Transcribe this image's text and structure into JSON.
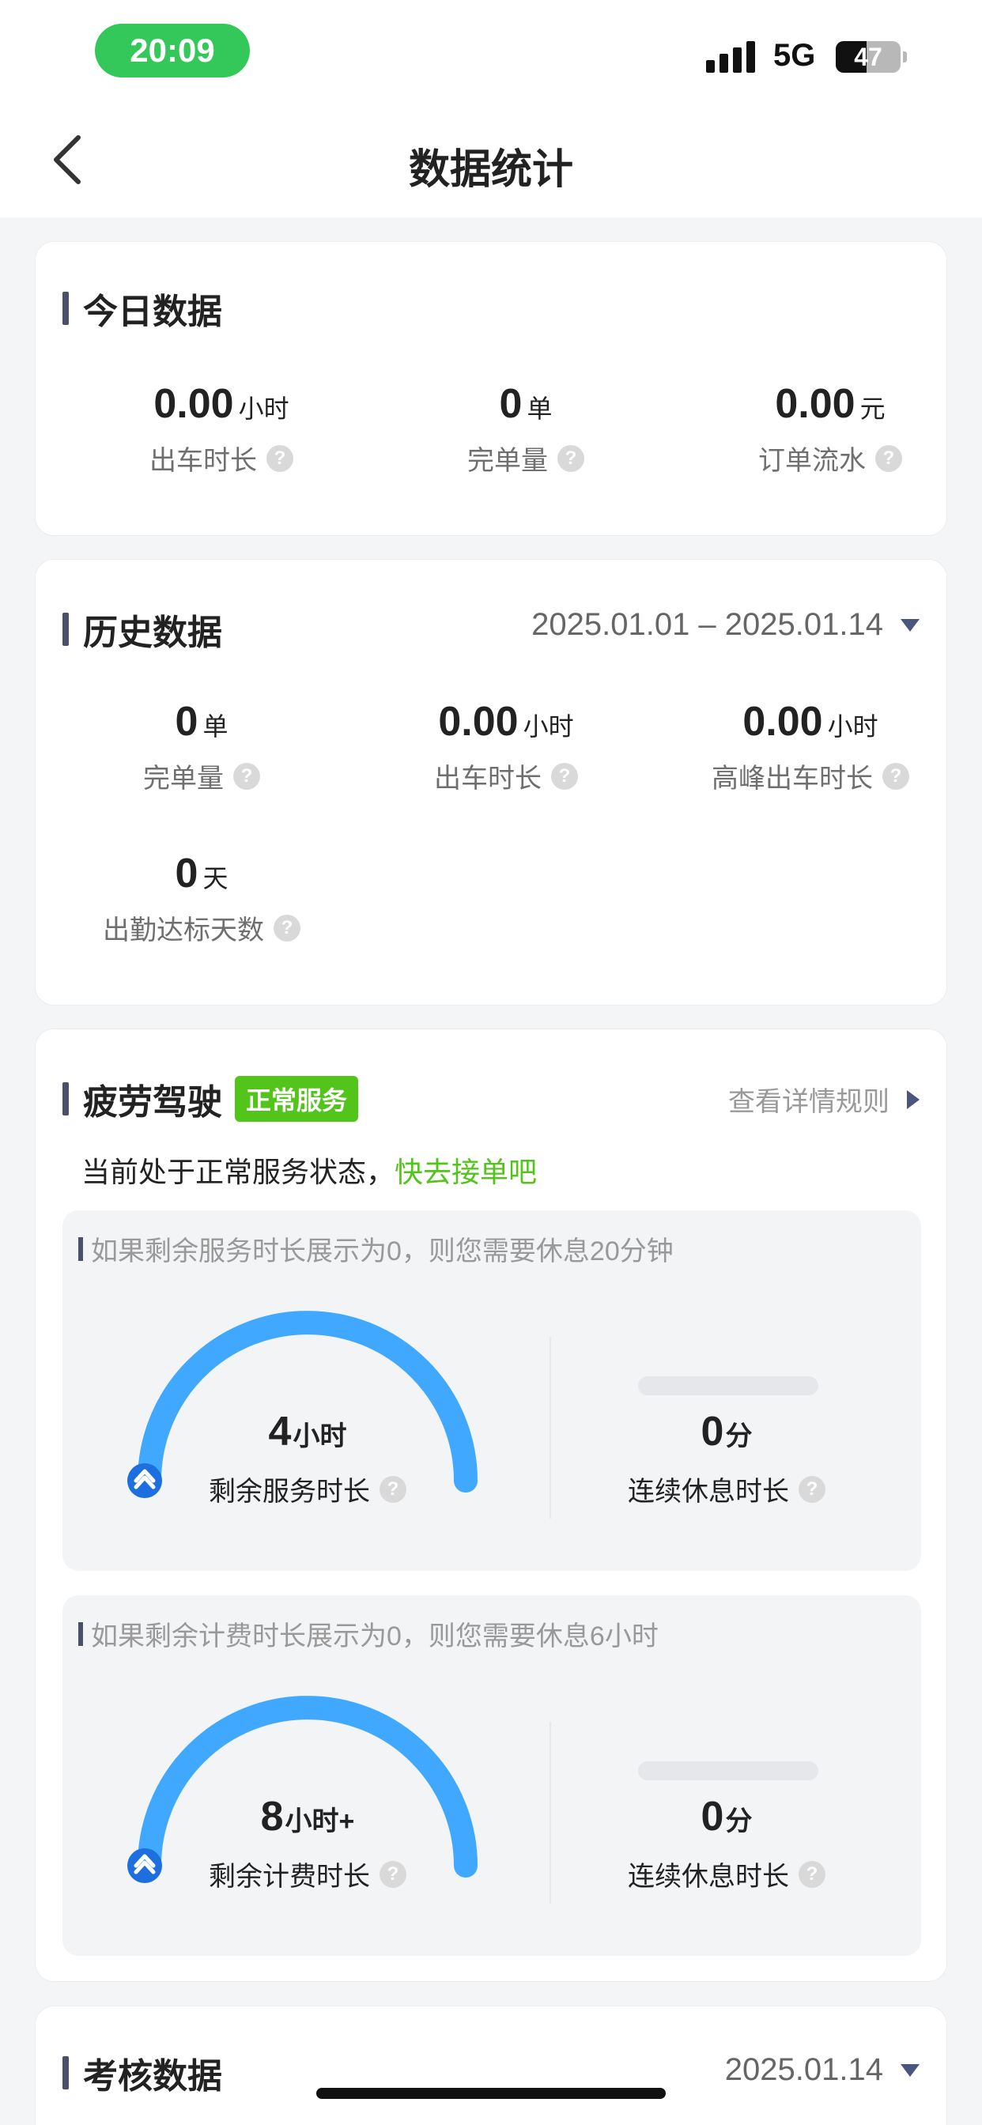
{
  "status_bar": {
    "time": "20:09",
    "network": "5G",
    "battery": "47",
    "battery_level": 0.47
  },
  "nav": {
    "title": "数据统计",
    "back_icon": "chevron-left-icon"
  },
  "today": {
    "title": "今日数据",
    "stats": [
      {
        "value": "0.00",
        "unit": "小时",
        "label": "出车时长"
      },
      {
        "value": "0",
        "unit": "单",
        "label": "完单量"
      },
      {
        "value": "0.00",
        "unit": "元",
        "label": "订单流水"
      }
    ]
  },
  "history": {
    "title": "历史数据",
    "date_range": "2025.01.01 – 2025.01.14",
    "stats": [
      {
        "value": "0",
        "unit": "单",
        "label": "完单量"
      },
      {
        "value": "0.00",
        "unit": "小时",
        "label": "出车时长"
      },
      {
        "value": "0.00",
        "unit": "小时",
        "label": "高峰出车时长"
      },
      {
        "value": "0",
        "unit": "天",
        "label": "出勤达标天数"
      }
    ]
  },
  "fatigue": {
    "title": "疲劳驾驶",
    "badge": "正常服务",
    "rules_link": "查看详情规则",
    "status_text": "当前处于正常服务状态，",
    "status_action": "快去接单吧",
    "panels": [
      {
        "hint": "如果剩余服务时长展示为0，则您需要休息20分钟",
        "gauge_value": "4",
        "gauge_unit": "小时",
        "gauge_label": "剩余服务时长",
        "rest_value": "0",
        "rest_unit": "分",
        "rest_label": "连续休息时长"
      },
      {
        "hint": "如果剩余计费时长展示为0，则您需要休息6小时",
        "gauge_value": "8",
        "gauge_unit": "小时+",
        "gauge_label": "剩余计费时长",
        "rest_value": "0",
        "rest_unit": "分",
        "rest_label": "连续休息时长"
      }
    ]
  },
  "assessment": {
    "title": "考核数据",
    "date": "2025.01.14"
  },
  "help_icon_glyph": "?",
  "colors": {
    "accent_green": "#52c41a",
    "gauge_blue": "#40a9ff",
    "marker_blue": "#1d6fe0",
    "status_green": "#34c759"
  }
}
